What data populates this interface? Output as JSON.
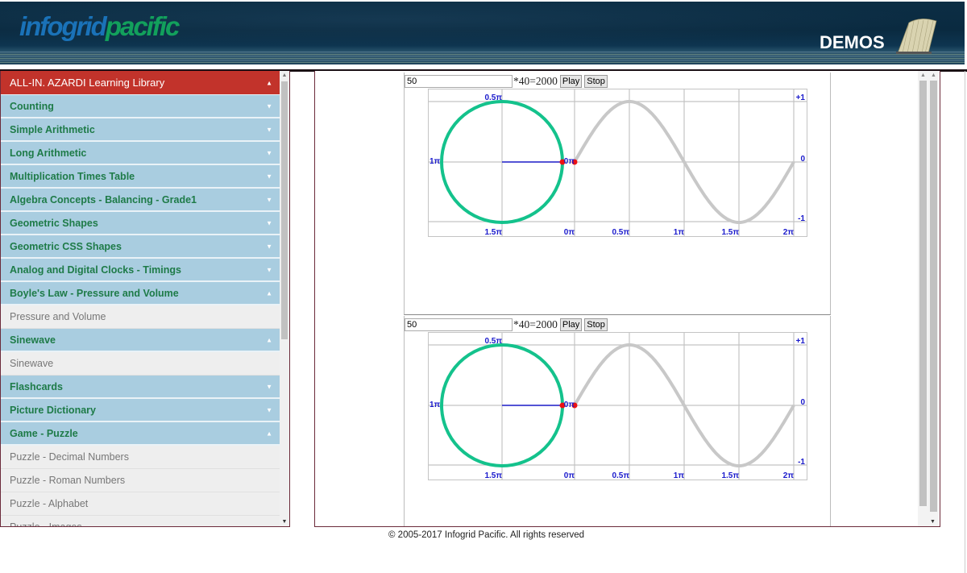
{
  "header": {
    "logo_part1": "infogrid",
    "logo_part2": "pacific",
    "demos_label": "DEMOS",
    "icons": {
      "book": "open-book-fan-icon"
    }
  },
  "sidebar": {
    "items": [
      {
        "label": "ALL-IN. AZARDI Learning Library",
        "type": "top",
        "expanded": true
      },
      {
        "label": "Counting",
        "type": "head",
        "expanded": false
      },
      {
        "label": "Simple Arithmetic",
        "type": "head",
        "expanded": false
      },
      {
        "label": "Long Arithmetic",
        "type": "head",
        "expanded": false
      },
      {
        "label": "Multiplication Times Table",
        "type": "head",
        "expanded": false
      },
      {
        "label": "Algebra Concepts - Balancing - Grade1",
        "type": "head",
        "expanded": false
      },
      {
        "label": "Geometric Shapes",
        "type": "head",
        "expanded": false
      },
      {
        "label": "Geometric CSS Shapes",
        "type": "head",
        "expanded": false
      },
      {
        "label": "Analog and Digital Clocks - Timings",
        "type": "head",
        "expanded": false
      },
      {
        "label": "Boyle's Law - Pressure and Volume",
        "type": "head",
        "expanded": true
      },
      {
        "label": "Pressure and Volume",
        "type": "sub"
      },
      {
        "label": "Sinewave",
        "type": "head",
        "expanded": true
      },
      {
        "label": "Sinewave",
        "type": "sub"
      },
      {
        "label": "Flashcards",
        "type": "head",
        "expanded": false
      },
      {
        "label": "Picture Dictionary",
        "type": "head",
        "expanded": false
      },
      {
        "label": "Game - Puzzle",
        "type": "head",
        "expanded": true
      },
      {
        "label": "Puzzle - Decimal Numbers",
        "type": "sub"
      },
      {
        "label": "Puzzle - Roman Numbers",
        "type": "sub"
      },
      {
        "label": "Puzzle - Alphabet",
        "type": "sub"
      },
      {
        "label": "Puzzle - Images",
        "type": "sub"
      }
    ],
    "arrow_up": "▲",
    "arrow_down": "▼"
  },
  "widgets": [
    {
      "input_value": "50",
      "formula": "*40=2000",
      "play_label": "Play",
      "stop_label": "Stop",
      "circle_labels": {
        "top": "0.5π",
        "left": "1π",
        "right": "0π",
        "bottom": "1.5π"
      },
      "x_ticks": [
        "0π",
        "0.5π",
        "1π",
        "1.5π",
        "2π"
      ],
      "y_ticks": [
        "+1",
        "0",
        "-1"
      ],
      "phase": 0
    },
    {
      "input_value": "50",
      "formula": "*40=2000",
      "play_label": "Play",
      "stop_label": "Stop",
      "circle_labels": {
        "top": "0.5π",
        "left": "1π",
        "right": "0π",
        "bottom": "1.5π"
      },
      "x_ticks": [
        "0π",
        "0.5π",
        "1π",
        "1.5π",
        "2π"
      ],
      "y_ticks": [
        "+1",
        "0",
        "-1"
      ],
      "phase": 0
    }
  ],
  "colors": {
    "circle": "#14c28c",
    "wave": "#c8c8c8",
    "radius": "#2020cc",
    "marker": "#ee1111",
    "label": "#1a1acc",
    "menu_top": "#c2332b",
    "menu_head": "#a9cde0",
    "menu_text": "#1e7b48"
  },
  "footer": {
    "copyright": "© 2005-2017 Infogrid Pacific. All rights reserved"
  }
}
